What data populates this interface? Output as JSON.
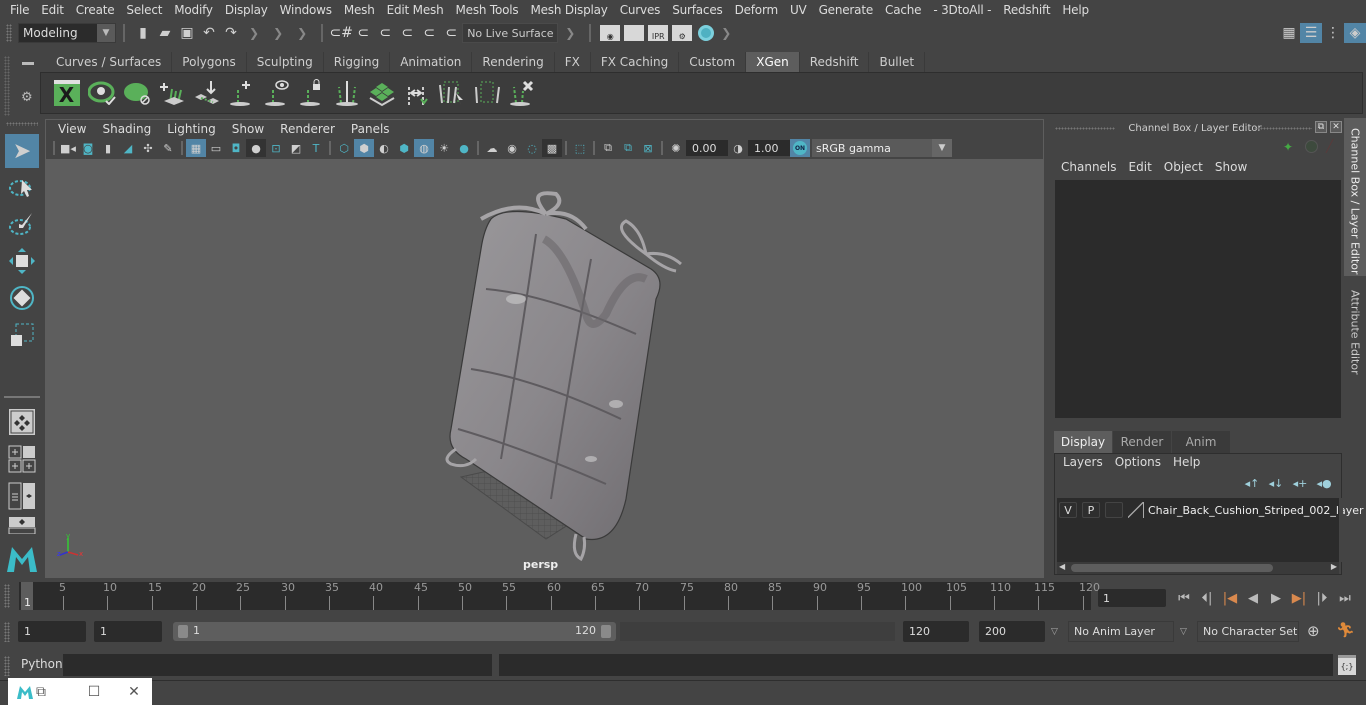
{
  "menubar": {
    "items": [
      "File",
      "Edit",
      "Create",
      "Select",
      "Modify",
      "Display",
      "Windows",
      "Mesh",
      "Edit Mesh",
      "Mesh Tools",
      "Mesh Display",
      "Curves",
      "Surfaces",
      "Deform",
      "UV",
      "Generate",
      "Cache",
      "- 3DtoAll -",
      "Redshift",
      "Help"
    ]
  },
  "statusline": {
    "mode": "Modeling",
    "live_surface": "No Live Surface",
    "render_ipr_label": "IPR"
  },
  "shelf": {
    "tabs": [
      "Curves / Surfaces",
      "Polygons",
      "Sculpting",
      "Rigging",
      "Animation",
      "Rendering",
      "FX",
      "FX Caching",
      "Custom",
      "XGen",
      "Redshift",
      "Bullet"
    ],
    "active_tab": "XGen",
    "xgen_glyph": "X"
  },
  "viewport": {
    "menu": [
      "View",
      "Shading",
      "Lighting",
      "Show",
      "Renderer",
      "Panels"
    ],
    "exposure": "0.00",
    "gamma": "1.00",
    "color_management_badge": "ON",
    "color_space": "sRGB gamma",
    "camera_label": "persp",
    "axis_labels": {
      "x": "x",
      "y": "y",
      "z": "z"
    }
  },
  "channel_box": {
    "title": "Channel Box / Layer Editor",
    "menu": [
      "Channels",
      "Edit",
      "Object",
      "Show"
    ]
  },
  "layer_editor": {
    "tabs": [
      "Display",
      "Render",
      "Anim"
    ],
    "active_tab": "Display",
    "menu": [
      "Layers",
      "Options",
      "Help"
    ],
    "layers": [
      {
        "visible": "V",
        "playback": "P",
        "name": "Chair_Back_Cushion_Striped_002_layer"
      }
    ]
  },
  "side_tabs": [
    "Channel Box / Layer Editor",
    "Attribute Editor"
  ],
  "timeline": {
    "ticks": [
      5,
      10,
      15,
      20,
      25,
      30,
      35,
      40,
      45,
      50,
      55,
      60,
      65,
      70,
      75,
      80,
      85,
      90,
      95,
      100,
      105,
      110,
      115,
      120
    ],
    "start_marker": "1",
    "current_frame": "1"
  },
  "range": {
    "start": "1",
    "playback_start": "1",
    "slider_min": "1",
    "slider_max": "120",
    "playback_end": "120",
    "end": "200",
    "anim_layer": "No Anim Layer",
    "character_set": "No Character Set"
  },
  "command_line": {
    "language": "Python",
    "input": "",
    "output": ""
  }
}
